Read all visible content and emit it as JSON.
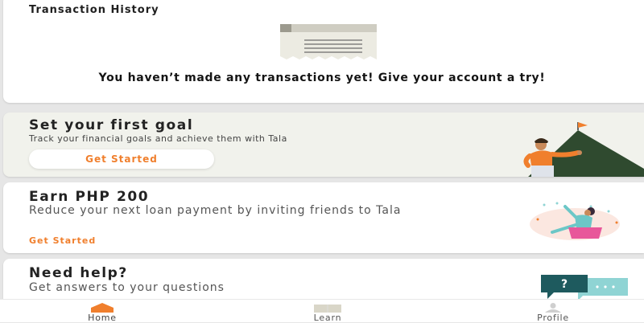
{
  "transactions": {
    "title": "Transaction History",
    "empty_message": "You haven’t made any transactions yet! Give your account a try!"
  },
  "goal_card": {
    "title": "Set your first goal",
    "subtitle": "Track your financial goals and achieve them with Tala",
    "button_label": "Get Started"
  },
  "earn_card": {
    "title": "Earn PHP 200",
    "subtitle": "Reduce your next loan payment by inviting friends to Tala",
    "link_label": "Get Started"
  },
  "help_card": {
    "title": "Need help?",
    "subtitle": "Get answers to your questions",
    "chat_icon_text": "?"
  },
  "nav": {
    "items": [
      {
        "label": "Home",
        "icon": "home-icon",
        "active": true
      },
      {
        "label": "Learn",
        "icon": "book-icon",
        "active": false
      },
      {
        "label": "Profile",
        "icon": "profile-icon",
        "active": false
      }
    ]
  },
  "colors": {
    "accent": "#f07f2d",
    "goal_card_bg": "#f1f2ec",
    "mountain": "#2f4a2f",
    "chat_dark": "#1e5a5e",
    "chat_light": "#8fd4d4"
  }
}
